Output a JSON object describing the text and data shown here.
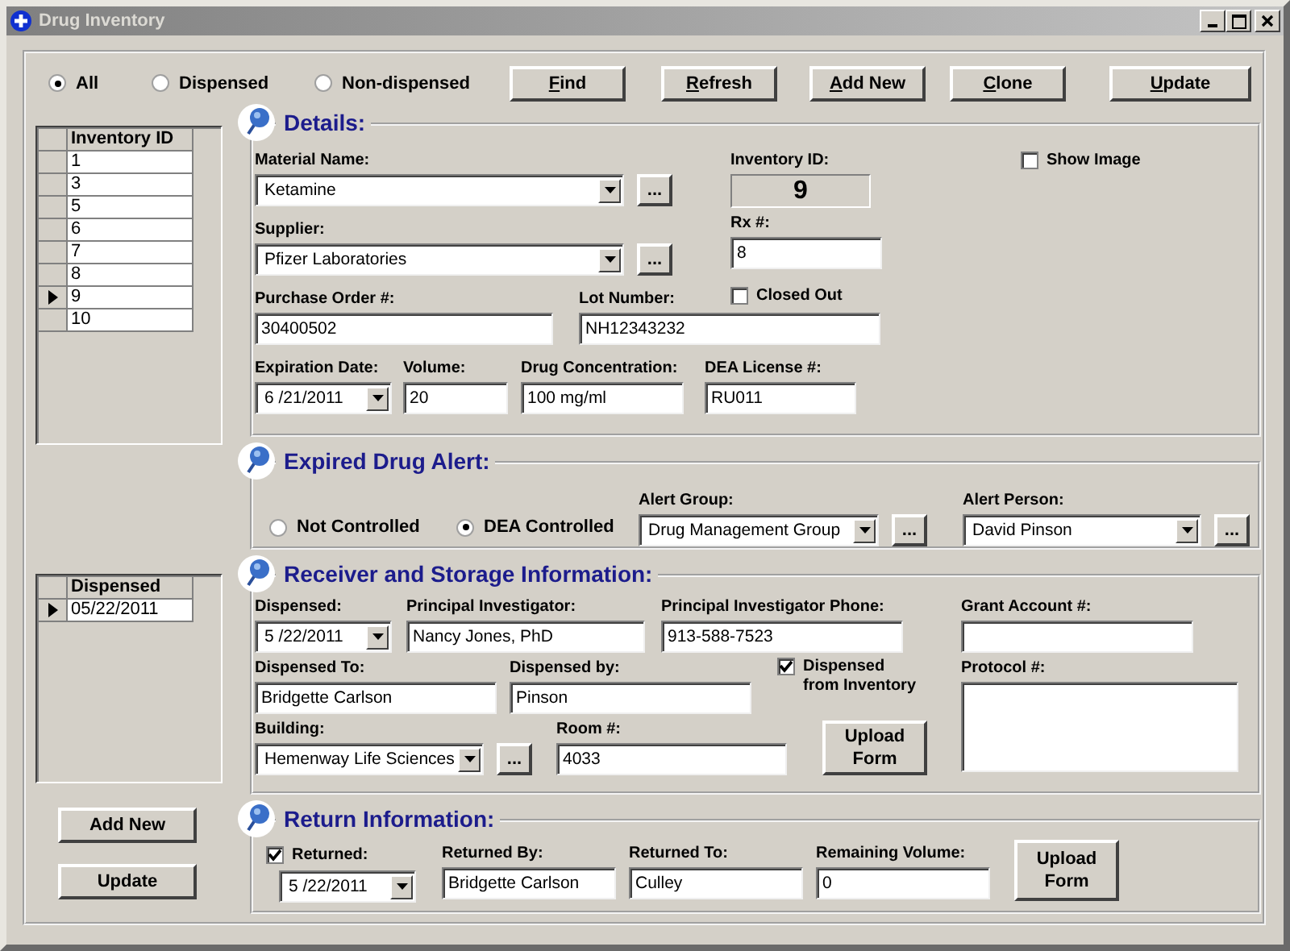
{
  "window": {
    "title": "Drug Inventory"
  },
  "filter": [
    {
      "label": "All",
      "selected": true
    },
    {
      "label": "Dispensed",
      "selected": false
    },
    {
      "label": "Non-dispensed",
      "selected": false
    }
  ],
  "toolbar": [
    "Find",
    "Refresh",
    "Add New",
    "Clone",
    "Update"
  ],
  "inventory_list": {
    "column": "Inventory ID",
    "rows": [
      {
        "id": "1",
        "selected": false
      },
      {
        "id": "3",
        "selected": false
      },
      {
        "id": "5",
        "selected": false
      },
      {
        "id": "6",
        "selected": false
      },
      {
        "id": "7",
        "selected": false
      },
      {
        "id": "8",
        "selected": false
      },
      {
        "id": "9",
        "selected": true
      },
      {
        "id": "10",
        "selected": false
      }
    ]
  },
  "dispensed_list": {
    "column": "Dispensed",
    "rows": [
      {
        "date": "05/22/2011",
        "selected": true
      }
    ]
  },
  "left_buttons": [
    "Add New",
    "Update"
  ],
  "details": {
    "title": "Details:",
    "material_name": {
      "label": "Material Name:",
      "value": "Ketamine",
      "button": "..."
    },
    "supplier": {
      "label": "Supplier:",
      "value": "Pfizer Laboratories",
      "button": "..."
    },
    "inventory_id": {
      "label": "Inventory ID:",
      "value": "9"
    },
    "rx_number": {
      "label": "Rx #:",
      "value": "8"
    },
    "closed_out": {
      "label": "Closed Out",
      "checked": false
    },
    "show_image": {
      "label": "Show Image",
      "checked": false
    },
    "purchase_order": {
      "label": "Purchase Order #:",
      "value": "30400502"
    },
    "lot_number": {
      "label": "Lot Number:",
      "value": "NH12343232"
    },
    "expiration_date": {
      "label": "Expiration Date:",
      "value": "6 /21/2011"
    },
    "volume": {
      "label": "Volume:",
      "value": "20"
    },
    "drug_concentration": {
      "label": "Drug Concentration:",
      "value": "100 mg/ml"
    },
    "dea_license": {
      "label": "DEA License #:",
      "value": "RU011"
    }
  },
  "expired_alert": {
    "title": "Expired Drug Alert:",
    "control": [
      {
        "label": "Not Controlled",
        "selected": false
      },
      {
        "label": "DEA Controlled",
        "selected": true
      }
    ],
    "alert_group": {
      "label": "Alert Group:",
      "value": "Drug Management Group",
      "button": "..."
    },
    "alert_person": {
      "label": "Alert Person:",
      "value": "David Pinson",
      "button": "..."
    }
  },
  "receiver": {
    "title": "Receiver and Storage Information:",
    "dispensed": {
      "label": "Dispensed:",
      "value": "5 /22/2011"
    },
    "principal_investigator": {
      "label": "Principal Investigator:",
      "value": "Nancy Jones, PhD"
    },
    "pi_phone": {
      "label": "Principal Investigator Phone:",
      "value": "913-588-7523"
    },
    "grant_account": {
      "label": "Grant Account #:"
    },
    "dispensed_to": {
      "label": "Dispensed To:",
      "value": "Bridgette Carlson"
    },
    "dispensed_by": {
      "label": "Dispensed by:",
      "value": "Pinson"
    },
    "dispensed_from_inventory": {
      "label": "Dispensed from Inventory",
      "checked": true
    },
    "protocol": {
      "label": "Protocol #:"
    },
    "building": {
      "label": "Building:",
      "value": "Hemenway Life Sciences",
      "button": "..."
    },
    "room": {
      "label": "Room #:",
      "value": "4033"
    },
    "upload_button": "Upload Form"
  },
  "return": {
    "title": "Return Information:",
    "returned": {
      "label": "Returned:",
      "checked": true,
      "value": "5 /22/2011"
    },
    "returned_by": {
      "label": "Returned By:",
      "value": "Bridgette Carlson"
    },
    "returned_to": {
      "label": "Returned To:",
      "value": "Culley"
    },
    "remaining_volume": {
      "label": "Remaining Volume:",
      "value": "0"
    },
    "upload_button": "Upload Form"
  }
}
